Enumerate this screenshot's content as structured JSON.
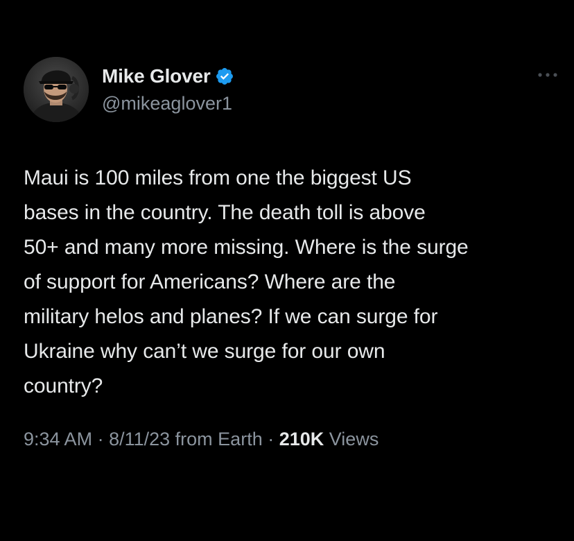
{
  "author": {
    "display_name": "Mike Glover",
    "handle": "@mikeaglover1",
    "verified": true,
    "avatar_icon": "user-photo-avatar"
  },
  "tweet": {
    "text": "Maui is 100 miles from one the biggest US\nbases in the country. The death toll is above\n50+ and many more missing. Where is the surge\nof support for Americans? Where are the\nmilitary helos and planes? If we can surge for\nUkraine why can’t we surge for our own\ncountry?",
    "time": "9:34 AM",
    "date": "8/11/23",
    "source": "from Earth",
    "views_count": "210K",
    "views_label": "Views"
  },
  "icons": {
    "verified": "verified-badge-icon",
    "more": "more-options-icon"
  },
  "colors": {
    "background": "#000000",
    "text_primary": "#e7e9ea",
    "text_secondary": "#8b949e",
    "verified_badge": "#1d9bf0"
  }
}
